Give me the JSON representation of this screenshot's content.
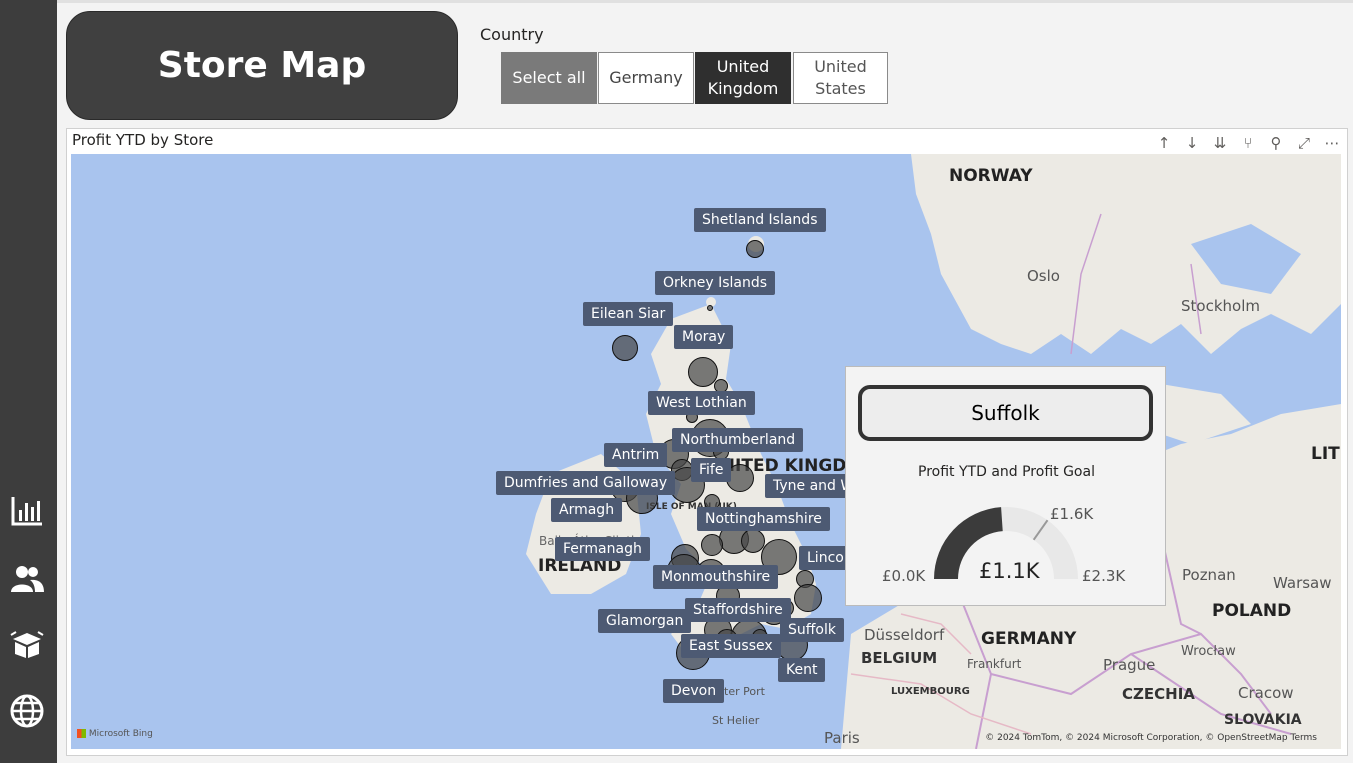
{
  "nav": {
    "icons": [
      "bar-chart-icon",
      "people-icon",
      "box-icon",
      "globe-icon"
    ]
  },
  "header": {
    "title": "Store Map"
  },
  "slicer": {
    "label": "Country",
    "options": [
      {
        "label": "Select all",
        "state": "partial"
      },
      {
        "label": "Germany",
        "state": "off"
      },
      {
        "label": "United Kingdom",
        "state": "on"
      },
      {
        "label": "United States",
        "state": "off"
      }
    ]
  },
  "visual": {
    "title": "Profit YTD by Store",
    "toolbar": [
      "↑",
      "↓",
      "⇊",
      "⑂",
      "⚲",
      "⤢",
      "⋯"
    ]
  },
  "map": {
    "labels": {
      "shetland": "Shetland Islands",
      "orkney": "Orkney Islands",
      "eilean": "Eilean Siar",
      "moray": "Moray",
      "westlothian": "West Lothian",
      "northumberland": "Northumberland",
      "antrim": "Antrim",
      "fife": "Fife",
      "dumfries": "Dumfries and Galloway",
      "tyne": "Tyne and W",
      "armagh": "Armagh",
      "nottingham": "Nottinghamshire",
      "fermanagh": "Fermanagh",
      "lincoln": "Lincol",
      "monmouth": "Monmouthshire",
      "stafford": "Staffordshire",
      "glamorgan": "Glamorgan",
      "suffolk": "Suffolk",
      "eastsussex": "East Sussex",
      "kent": "Kent",
      "devon": "Devon"
    },
    "places": {
      "norway": "NORWAY",
      "oslo": "Oslo",
      "stockholm": "Stockholm",
      "uk": "UNITED KINGDOM",
      "isleofman": "ISLE OF MAN (UK)",
      "ireland": "IRELAND",
      "baileatha": "Baile Átha Cliath",
      "lith": "LITH",
      "poznan": "Poznan",
      "warsaw": "Warsaw",
      "poland": "POLAND",
      "dusseldorf": "Düsseldorf",
      "germany": "GERMANY",
      "belgium": "BELGIUM",
      "frankfurt": "Frankfurt",
      "luxembourg": "LUXEMBOURG",
      "prague": "Prague",
      "wroclaw": "Wrocław",
      "czechia": "CZECHIA",
      "cracow": "Cracow",
      "slovakia": "SLOVAKIA",
      "paris": "Paris",
      "peterport": "Peter Port",
      "sthelier": "St Helier"
    },
    "bing": "Microsoft Bing",
    "attribution": "© 2024 TomTom, © 2024 Microsoft Corporation, © OpenStreetMap  Terms"
  },
  "tooltip": {
    "store": "Suffolk",
    "subtitle": "Profit YTD and Profit Goal",
    "gauge": {
      "min_label": "£0.0K",
      "max_label": "£2.3K",
      "value_label": "£1.1K",
      "target_label": "£1.6K",
      "value": 1.1,
      "min": 0,
      "max": 2.3,
      "target": 1.6
    }
  },
  "colors": {
    "rail": "#3d3d3d",
    "title_card": "#404040",
    "selected": "#2f2f2f",
    "partial": "#7a7a7a",
    "water": "#a9c4ee",
    "land": "#eceae4",
    "bubble": "#474747",
    "pill": "#4d5a73",
    "gauge_fill": "#3b3b3b",
    "gauge_track": "#e8e8e8"
  }
}
